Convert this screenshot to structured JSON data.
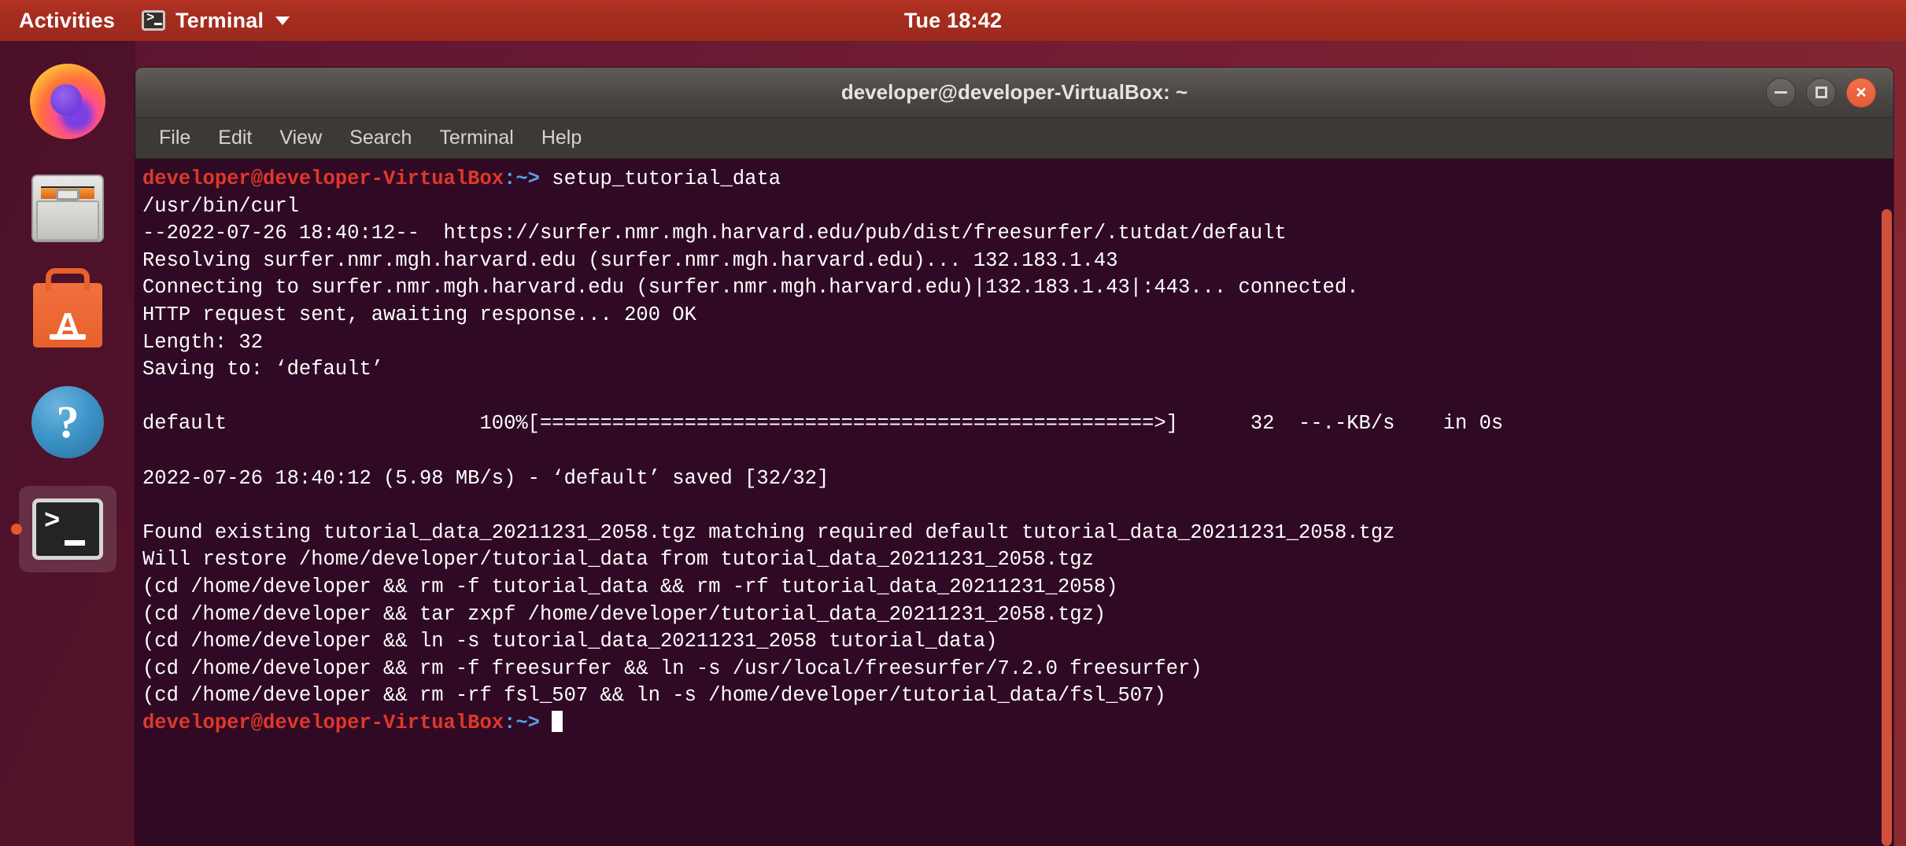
{
  "topbar": {
    "activities_label": "Activities",
    "app_menu_label": "Terminal",
    "app_icon": "terminal-icon",
    "caret_icon": "chevron-down-icon",
    "clock": "Tue 18:42",
    "background_color": "#a52d1f"
  },
  "dock": {
    "items": [
      {
        "name": "firefox",
        "icon": "firefox-icon",
        "label": "Firefox",
        "active": false
      },
      {
        "name": "files",
        "icon": "files-cabinet-icon",
        "label": "Files",
        "active": false
      },
      {
        "name": "software",
        "icon": "ubuntu-software-bag-icon",
        "label": "Ubuntu Software",
        "glyph": "A",
        "active": false
      },
      {
        "name": "help",
        "icon": "help-question-icon",
        "label": "Help",
        "glyph": "?",
        "active": false
      },
      {
        "name": "terminal",
        "icon": "terminal-icon",
        "label": "Terminal",
        "glyph": ">",
        "active": true
      }
    ]
  },
  "window": {
    "title": "developer@developer-VirtualBox: ~",
    "buttons": {
      "minimize": "minimize-icon",
      "maximize": "maximize-icon",
      "close": "×"
    },
    "menu": [
      "File",
      "Edit",
      "View",
      "Search",
      "Terminal",
      "Help"
    ],
    "background_color": "#300a24",
    "foreground_color": "#ffffff",
    "prompt_color": "#e0382a",
    "path_color": "#5aa0e6",
    "scrollbar_color": "#d2503a"
  },
  "terminal": {
    "prompt_user": "developer@developer-VirtualBox",
    "prompt_path": ":~>",
    "command": " setup_tutorial_data",
    "lines": [
      "/usr/bin/curl",
      "--2022-07-26 18:40:12--  https://surfer.nmr.mgh.harvard.edu/pub/dist/freesurfer/.tutdat/default",
      "Resolving surfer.nmr.mgh.harvard.edu (surfer.nmr.mgh.harvard.edu)... 132.183.1.43",
      "Connecting to surfer.nmr.mgh.harvard.edu (surfer.nmr.mgh.harvard.edu)|132.183.1.43|:443... connected.",
      "HTTP request sent, awaiting response... 200 OK",
      "Length: 32",
      "Saving to: ‘default’",
      "",
      "default                     100%[===================================================>]      32  --.-KB/s    in 0s",
      "",
      "2022-07-26 18:40:12 (5.98 MB/s) - ‘default’ saved [32/32]",
      "",
      "Found existing tutorial_data_20211231_2058.tgz matching required default tutorial_data_20211231_2058.tgz",
      "Will restore /home/developer/tutorial_data from tutorial_data_20211231_2058.tgz",
      "(cd /home/developer && rm -f tutorial_data && rm -rf tutorial_data_20211231_2058)",
      "(cd /home/developer && tar zxpf /home/developer/tutorial_data_20211231_2058.tgz)",
      "(cd /home/developer && ln -s tutorial_data_20211231_2058 tutorial_data)",
      "(cd /home/developer && rm -f freesurfer && ln -s /usr/local/freesurfer/7.2.0 freesurfer)",
      "(cd /home/developer && rm -rf fsl_507 && ln -s /home/developer/tutorial_data/fsl_507)"
    ],
    "final_prompt_user": "developer@developer-VirtualBox",
    "final_prompt_path": ":~>",
    "cursor": "block"
  }
}
